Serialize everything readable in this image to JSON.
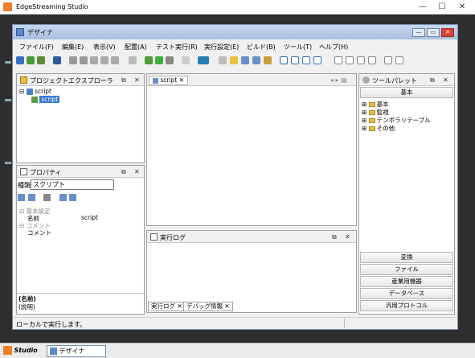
{
  "app": {
    "title": "EdgeStreaming Studio"
  },
  "window_controls": {
    "minimize": "—",
    "maximize": "☐",
    "close": "✕"
  },
  "designer": {
    "title": "デザイナ",
    "controls": {
      "minimize": "—",
      "restore": "▭",
      "close": "✕"
    },
    "menu": [
      "ファイル(F)",
      "編集(E)",
      "表示(V)",
      "配置(A)",
      "テスト実行(R)",
      "実行設定(E)",
      "ビルド(B)",
      "ツール(T)",
      "ヘルプ(H)"
    ]
  },
  "project_explorer": {
    "title": "プロジェクトエクスプローラ",
    "tree": [
      {
        "label": "script",
        "expander": "⊟"
      },
      {
        "label": "script",
        "selected": true
      }
    ],
    "controls": {
      "dock": "⧉",
      "close": "✕"
    }
  },
  "editor": {
    "tab_label": "script",
    "tab_close": "✕",
    "nav_arrows": "◂ ▸ ▤"
  },
  "properties": {
    "title": "プロパティ",
    "type_label": "種類:",
    "type_value": "スクリプト",
    "rows": [
      {
        "kind": "category",
        "label": "⊟ 基本設定"
      },
      {
        "kind": "prop",
        "name": "名前",
        "value": "script"
      },
      {
        "kind": "category",
        "label": "⊟ コメント"
      },
      {
        "kind": "prop",
        "name": "コメント",
        "value": ""
      }
    ],
    "description_title": "(名前)",
    "description_text": "(説明)",
    "controls": {
      "dock": "⧉",
      "close": "✕"
    }
  },
  "exec_log": {
    "title": "実行ログ",
    "controls": {
      "dock": "⧉",
      "close": "✕"
    },
    "bottom_tabs": [
      {
        "label": "実行ログ",
        "close": "✕"
      },
      {
        "label": "デバッグ情報",
        "close": "✕"
      }
    ]
  },
  "tool_palette": {
    "title": "ツールパレット",
    "active_category": "基本",
    "tree": [
      "基本",
      "監視",
      "テンポラリテーブル",
      "その他"
    ],
    "categories": [
      "変換",
      "ファイル",
      "産業用機器",
      "データベース",
      "汎用プロトコル"
    ],
    "controls": {
      "dock": "⧉",
      "close": "✕"
    }
  },
  "status": {
    "message": "ローカルで実行します。"
  },
  "taskbar": {
    "items": [
      {
        "label": "Studio",
        "active": false
      },
      {
        "label": "デザイナ",
        "active": true
      }
    ]
  },
  "colors": {
    "accent_orange": "#f08028",
    "designer_title_top": "#c8d8ee",
    "workspace": "#2e2e2e",
    "selection": "#3779d1"
  }
}
